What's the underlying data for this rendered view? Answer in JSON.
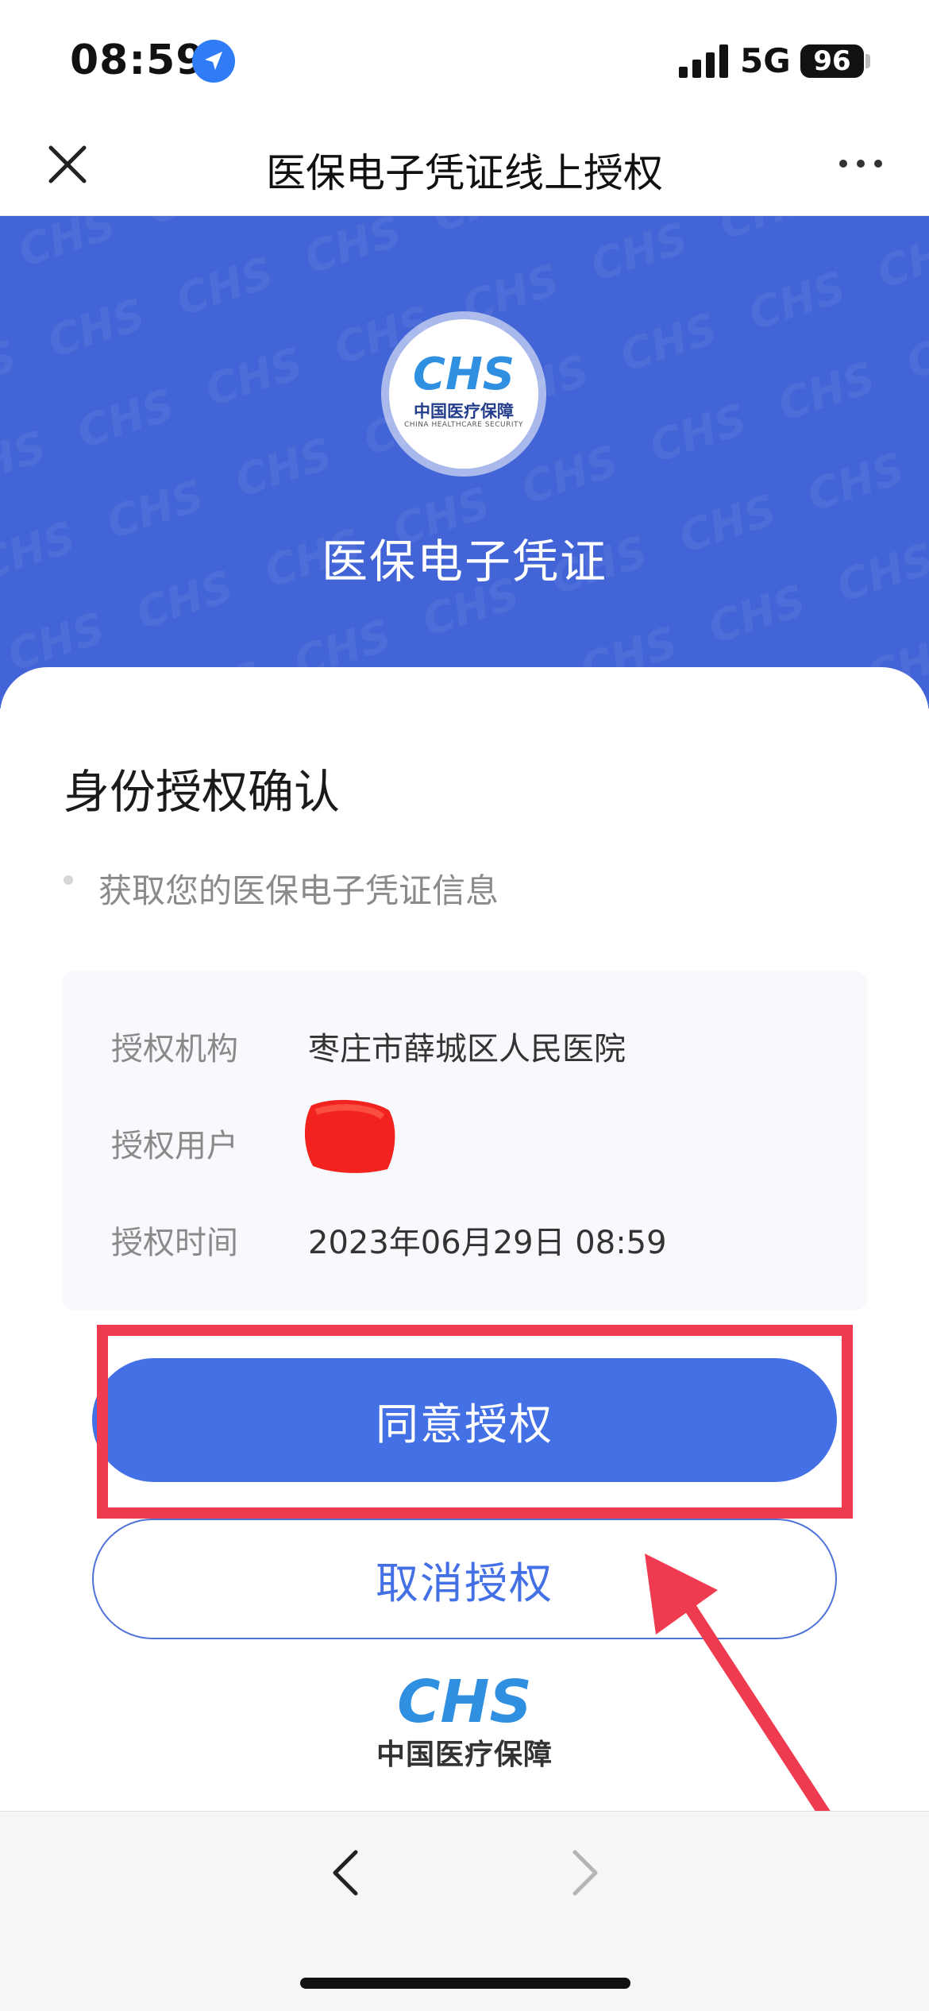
{
  "status_bar": {
    "time": "08:59",
    "network": "5G",
    "battery": "96",
    "icons": [
      "location-arrow-icon",
      "signal-bars-icon"
    ]
  },
  "nav": {
    "title": "医保电子凭证线上授权",
    "close_icon": "close-icon",
    "more_icon": "more-dots-icon"
  },
  "hero": {
    "logo_text": "CHS",
    "logo_cn": "中国医疗保障",
    "logo_en": "CHINA HEALTHCARE SECURITY",
    "title": "医保电子凭证",
    "color": "#4364d6"
  },
  "auth": {
    "section_title": "身份授权确认",
    "scope_item": "获取您的医保电子凭证信息",
    "details": [
      {
        "label": "授权机构",
        "value": "枣庄市薛城区人民医院"
      },
      {
        "label": "授权用户",
        "value": ""
      },
      {
        "label": "授权时间",
        "value": "2023年06月29日 08:59"
      }
    ]
  },
  "actions": {
    "agree_label": "同意授权",
    "cancel_label": "取消授权",
    "accent_color": "#4470e6",
    "highlight_color": "#ee3b50"
  },
  "footer": {
    "logo_text": "CHS",
    "logo_cn": "中国医疗保障"
  },
  "browser": {
    "back_icon": "chevron-left-icon",
    "forward_icon": "chevron-right-icon"
  }
}
